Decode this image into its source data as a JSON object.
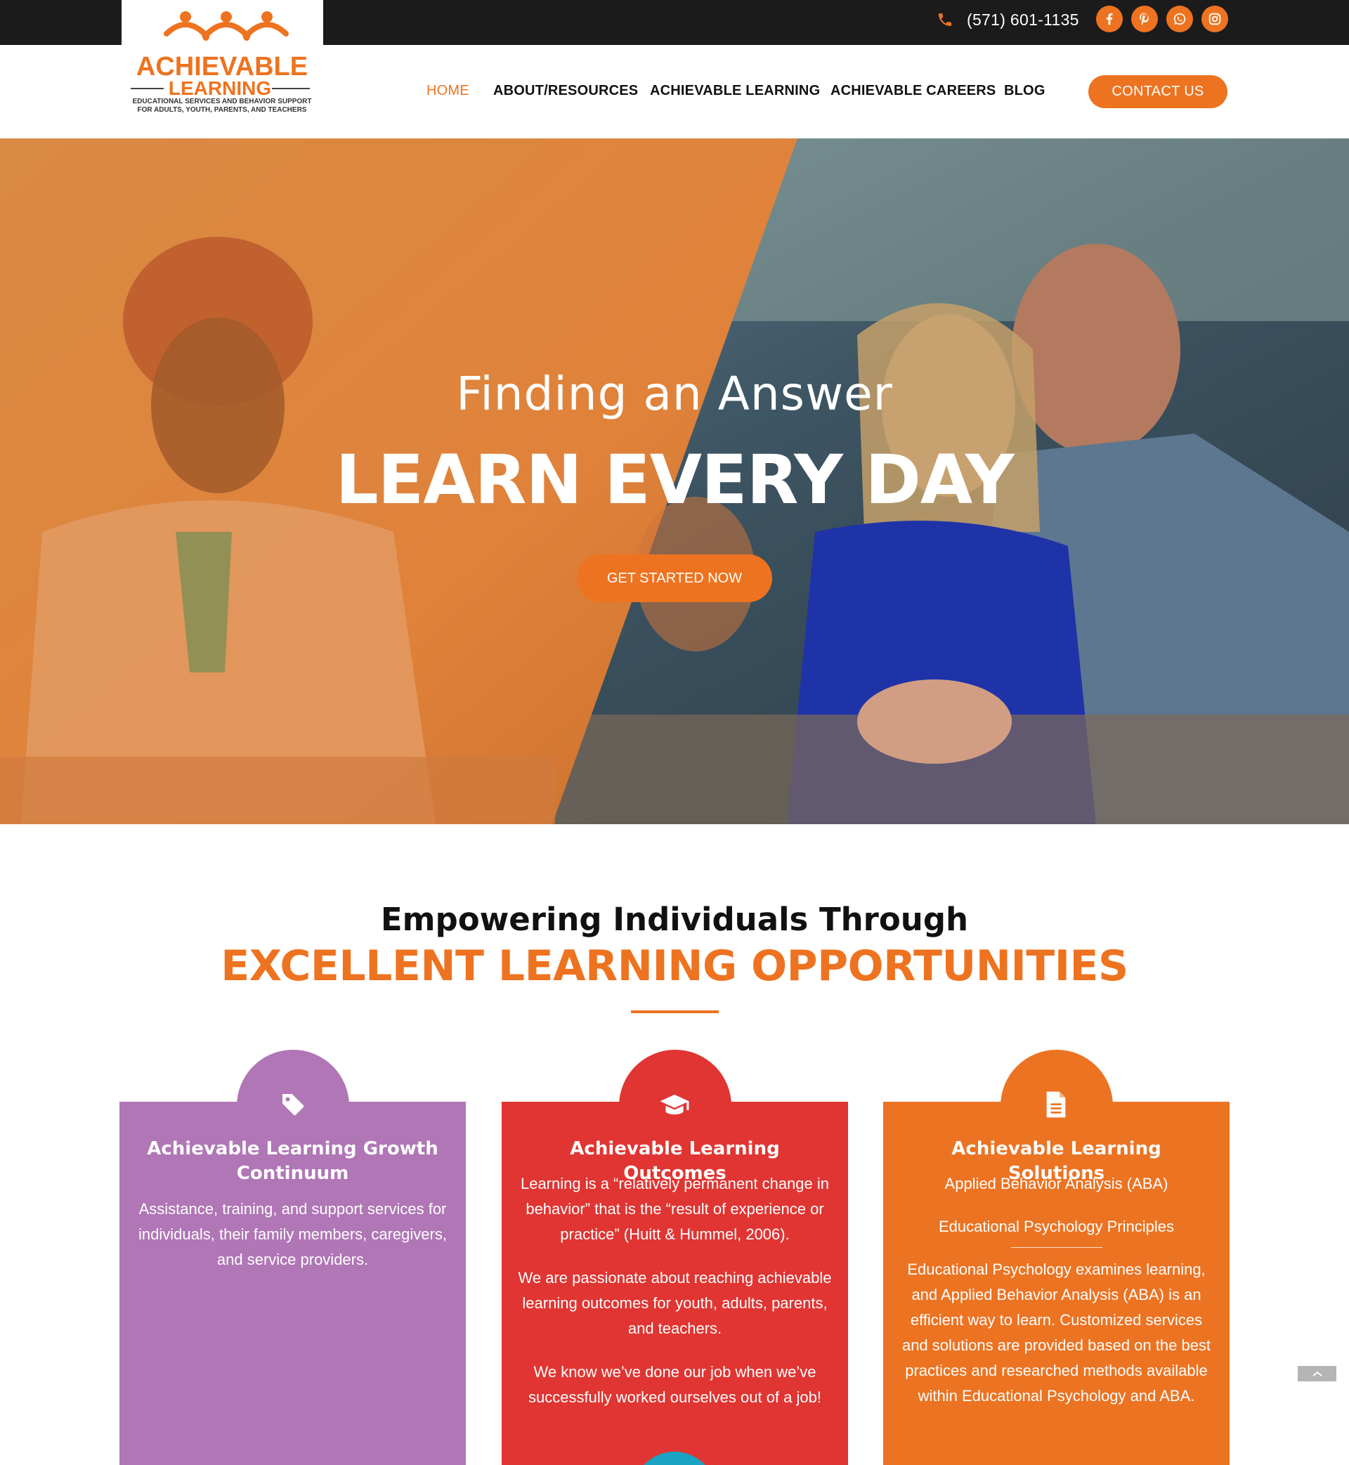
{
  "topbar": {
    "phone": "(571) 601-1135",
    "social": [
      "facebook-icon",
      "pinterest-icon",
      "whatsapp-icon",
      "instagram-icon"
    ]
  },
  "logo": {
    "line1": "ACHIEVABLE",
    "line2": "LEARNING",
    "tagline1": "EDUCATIONAL SERVICES AND BEHAVIOR SUPPORT",
    "tagline2": "FOR ADULTS, YOUTH, PARENTS, AND TEACHERS"
  },
  "nav": {
    "items": [
      "HOME",
      "ABOUT/RESOURCES",
      "ACHIEVABLE LEARNING",
      "ACHIEVABLE CAREERS",
      "BLOG"
    ],
    "active": "HOME",
    "contact": "CONTACT US"
  },
  "hero": {
    "subtitle": "Finding an Answer",
    "title": "LEARN EVERY DAY",
    "button": "GET STARTED NOW"
  },
  "intro": {
    "heading": "Empowering Individuals Through",
    "highlight": "EXCELLENT LEARNING OPPORTUNITIES"
  },
  "cards": [
    {
      "icon": "tag-icon",
      "color": "#b076b6",
      "title": "Achievable Learning Growth Continuum",
      "paragraphs": [
        "Assistance, training, and support services for individuals, their family members, caregivers, and service providers."
      ]
    },
    {
      "icon": "graduation-cap-icon",
      "color": "#e03532",
      "title": "Achievable Learning Outcomes",
      "paragraphs": [
        "Learning is a “relatively permanent change in behavior” that is the “result of experience or practice” (Huitt & Hummel, 2006).",
        "We are passionate about reaching achievable learning outcomes for youth, adults, parents, and teachers.",
        "We know we’ve done our job when we’ve successfully worked ourselves out of a job!"
      ]
    },
    {
      "icon": "document-icon",
      "color": "#ec7322",
      "title": "Achievable Learning Solutions",
      "paragraphs": [
        "Applied Behavior Analysis (ABA)",
        "Educational Psychology Principles",
        "Educational Psychology examines learning, and Applied Behavior Analysis (ABA) is an efficient way to learn. Customized services and solutions are provided based on the best practices and researched methods available within Educational Psychology and ABA."
      ]
    }
  ],
  "colors": {
    "accent": "#ee7320",
    "topbar": "#1b1b1b",
    "teal": "#1ba3c4"
  }
}
